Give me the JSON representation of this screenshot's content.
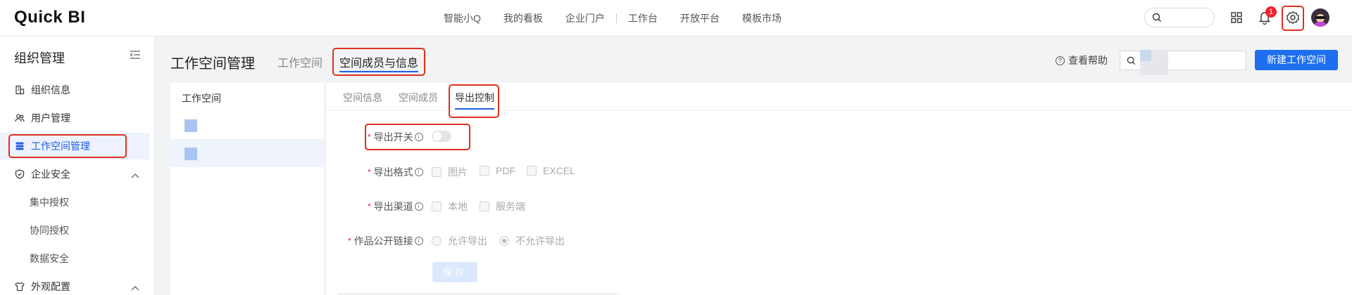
{
  "app": {
    "logo_text": "Quick BI"
  },
  "topnav": {
    "items": [
      "智能小Q",
      "我的看板",
      "企业门户",
      "工作台",
      "开放平台",
      "模板市场"
    ],
    "notification_count": "1"
  },
  "sidebar": {
    "title": "组织管理",
    "items": [
      {
        "label": "组织信息",
        "icon": "building-icon"
      },
      {
        "label": "用户管理",
        "icon": "users-icon"
      },
      {
        "label": "工作空间管理",
        "icon": "database-icon",
        "active": true
      },
      {
        "label": "企业安全",
        "icon": "shield-icon",
        "expanded": true
      },
      {
        "label": "集中授权"
      },
      {
        "label": "协同授权"
      },
      {
        "label": "数据安全"
      },
      {
        "label": "外观配置",
        "icon": "shirt-icon",
        "expanded": true
      }
    ]
  },
  "header": {
    "title": "工作空间管理",
    "tabs": [
      "工作空间",
      "空间成员与信息"
    ],
    "active_tab": "空间成员与信息",
    "help_label": "查看帮助",
    "primary_button": "新建工作空间"
  },
  "workspace_panel": {
    "title": "工作空间"
  },
  "subtabs": {
    "items": [
      "空间信息",
      "空间成员",
      "导出控制"
    ],
    "active": "导出控制"
  },
  "form": {
    "export_switch_label": "导出开关",
    "export_switch_on": false,
    "format_label": "导出格式",
    "format_options": [
      "图片",
      "PDF",
      "EXCEL"
    ],
    "channel_label": "导出渠道",
    "channel_options": [
      "本地",
      "服务端"
    ],
    "public_link_label": "作品公开链接",
    "public_link_options": [
      "允许导出",
      "不允许导出"
    ],
    "public_link_selected": "不允许导出",
    "save_label": "保存"
  },
  "colors": {
    "accent": "#1e6ff0",
    "highlight_box": "#e0301e",
    "active_bg": "#edf2fd"
  }
}
